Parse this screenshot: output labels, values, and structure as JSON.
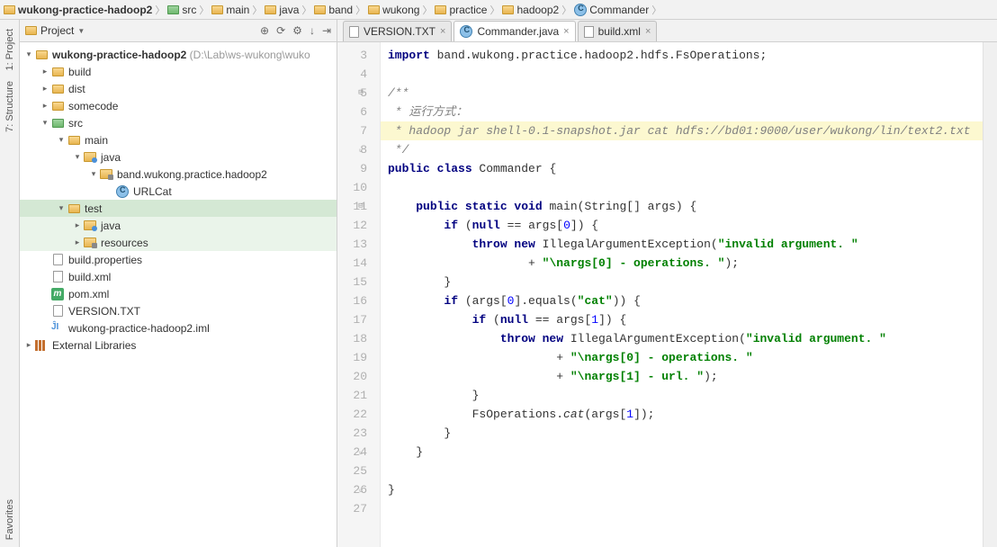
{
  "breadcrumb": [
    {
      "icon": "folder",
      "label": "wukong-practice-hadoop2",
      "bold": true
    },
    {
      "icon": "src-folder",
      "label": "src"
    },
    {
      "icon": "folder",
      "label": "main"
    },
    {
      "icon": "folder",
      "label": "java"
    },
    {
      "icon": "folder",
      "label": "band"
    },
    {
      "icon": "folder",
      "label": "wukong"
    },
    {
      "icon": "folder",
      "label": "practice"
    },
    {
      "icon": "folder",
      "label": "hadoop2"
    },
    {
      "icon": "class",
      "label": "Commander"
    }
  ],
  "leftTabs": {
    "project": "1: Project",
    "structure": "7: Structure",
    "favorites": "Favorites"
  },
  "projectPanel": {
    "title": "Project",
    "tools": [
      "⊕",
      "⟳",
      "⚙",
      "↓",
      "⇥"
    ]
  },
  "tree": [
    {
      "depth": 0,
      "exp": "▾",
      "icon": "folder",
      "label": "wukong-practice-hadoop2",
      "dim": " (D:\\Lab\\ws-wukong\\wuko",
      "bold": true
    },
    {
      "depth": 1,
      "exp": "▸",
      "icon": "folder",
      "label": "build"
    },
    {
      "depth": 1,
      "exp": "▸",
      "icon": "folder",
      "label": "dist"
    },
    {
      "depth": 1,
      "exp": "▸",
      "icon": "folder",
      "label": "somecode"
    },
    {
      "depth": 1,
      "exp": "▾",
      "icon": "src-folder",
      "label": "src"
    },
    {
      "depth": 2,
      "exp": "▾",
      "icon": "folder",
      "label": "main"
    },
    {
      "depth": 3,
      "exp": "▾",
      "icon": "java-folder",
      "label": "java"
    },
    {
      "depth": 4,
      "exp": "▾",
      "icon": "pkg",
      "label": "band.wukong.practice.hadoop2"
    },
    {
      "depth": 5,
      "exp": "",
      "icon": "class",
      "label": "URLCat"
    },
    {
      "depth": 2,
      "exp": "▾",
      "icon": "folder",
      "label": "test",
      "sel": "sel"
    },
    {
      "depth": 3,
      "exp": "▸",
      "icon": "java-folder",
      "label": "java",
      "sel": "sel-light"
    },
    {
      "depth": 3,
      "exp": "▸",
      "icon": "pkg",
      "label": "resources",
      "sel": "sel-light"
    },
    {
      "depth": 1,
      "exp": "",
      "icon": "file",
      "label": "build.properties"
    },
    {
      "depth": 1,
      "exp": "",
      "icon": "xml",
      "label": "build.xml"
    },
    {
      "depth": 1,
      "exp": "",
      "icon": "m",
      "label": "pom.xml"
    },
    {
      "depth": 1,
      "exp": "",
      "icon": "file",
      "label": "VERSION.TXT"
    },
    {
      "depth": 1,
      "exp": "",
      "icon": "ij",
      "label": "wukong-practice-hadoop2.iml"
    },
    {
      "depth": 0,
      "exp": "▸",
      "icon": "lib",
      "label": "External Libraries"
    }
  ],
  "tabs": [
    {
      "icon": "file",
      "label": "VERSION.TXT",
      "active": false
    },
    {
      "icon": "class",
      "label": "Commander.java",
      "active": true
    },
    {
      "icon": "xml",
      "label": "build.xml",
      "active": false
    }
  ],
  "code": {
    "startLine": 3,
    "lines": [
      {
        "n": 3,
        "html": "<span class='kw'>import</span> band.wukong.practice.hadoop2.hdfs.FsOperations;"
      },
      {
        "n": 4,
        "html": ""
      },
      {
        "n": 5,
        "fold": "⊟",
        "html": "<span class='cm'>/**</span>"
      },
      {
        "n": 6,
        "html": "<span class='cm'> * 运行方式：</span>"
      },
      {
        "n": 7,
        "hl": true,
        "html": "<span class='cm'> * hadoop jar shell-0.1-snapshot.jar cat hdfs://bd01:9000/user/wukong/lin/text2.txt</span>"
      },
      {
        "n": 8,
        "fold": "⌞",
        "html": "<span class='cm'> */</span>"
      },
      {
        "n": 9,
        "html": "<span class='kw'>public class</span> Commander {"
      },
      {
        "n": 10,
        "html": ""
      },
      {
        "n": 11,
        "fold": "⊟",
        "html": "    <span class='kw'>public static void</span> main(String[] args) {"
      },
      {
        "n": 12,
        "html": "        <span class='kw'>if</span> (<span class='kw'>null</span> == args[<span class='num'>0</span>]) {"
      },
      {
        "n": 13,
        "html": "            <span class='kw'>throw new</span> IllegalArgumentException(<span class='str'>\"invalid argument. \"</span>"
      },
      {
        "n": 14,
        "html": "                    + <span class='str'>\"\\nargs[0] - operations. \"</span>);"
      },
      {
        "n": 15,
        "html": "        }"
      },
      {
        "n": 16,
        "html": "        <span class='kw'>if</span> (args[<span class='num'>0</span>].equals(<span class='str'>\"cat\"</span>)) {"
      },
      {
        "n": 17,
        "html": "            <span class='kw'>if</span> (<span class='kw'>null</span> == args[<span class='num'>1</span>]) {"
      },
      {
        "n": 18,
        "html": "                <span class='kw'>throw new</span> IllegalArgumentException(<span class='str'>\"invalid argument. \"</span>"
      },
      {
        "n": 19,
        "html": "                        + <span class='str'>\"\\nargs[0] - operations. \"</span>"
      },
      {
        "n": 20,
        "html": "                        + <span class='str'>\"\\nargs[1] - url. \"</span>);"
      },
      {
        "n": 21,
        "html": "            }"
      },
      {
        "n": 22,
        "html": "            FsOperations.<span class='fn-it'>cat</span>(args[<span class='num'>1</span>]);"
      },
      {
        "n": 23,
        "html": "        }"
      },
      {
        "n": 24,
        "fold": "⌞",
        "html": "    }"
      },
      {
        "n": 25,
        "html": ""
      },
      {
        "n": 26,
        "fold": "⌞",
        "html": "}"
      },
      {
        "n": 27,
        "html": ""
      }
    ]
  }
}
